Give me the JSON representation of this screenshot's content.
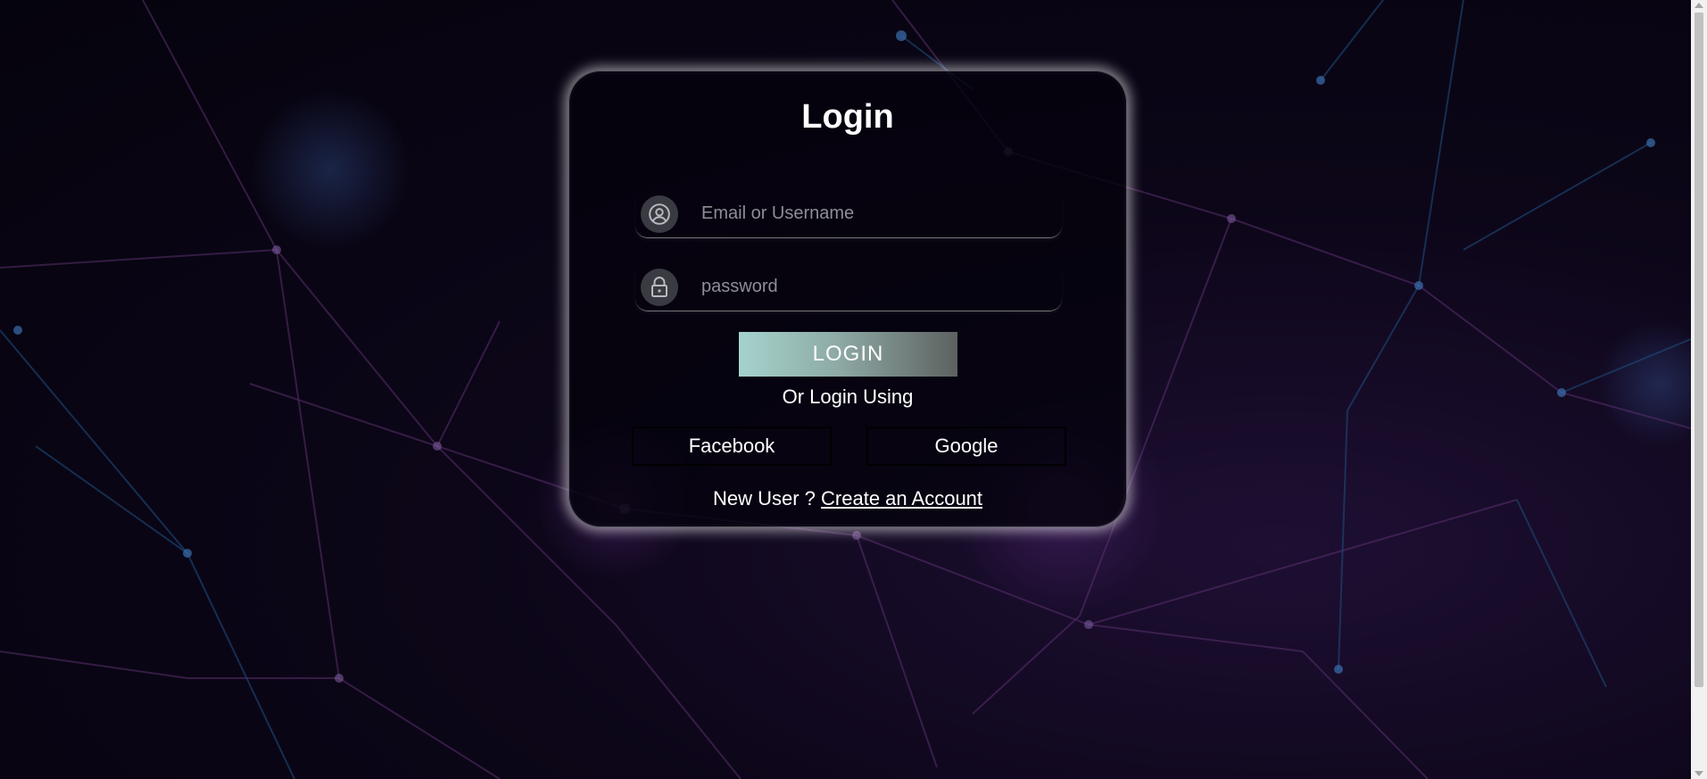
{
  "login": {
    "title": "Login",
    "email_placeholder": "Email or Username",
    "password_placeholder": "password",
    "login_button": "LOGIN",
    "or_text": "Or Login Using",
    "facebook_button": "Facebook",
    "google_button": "Google",
    "new_user_text": "New User ?",
    "create_account_link": "Create an Account"
  },
  "icons": {
    "email": "user-circle-icon",
    "password": "lock-icon"
  },
  "colors": {
    "background": "#0a0616",
    "card_background": "#05020e",
    "card_glow": "#ffffff",
    "login_gradient_start": "#a5d3cc",
    "login_gradient_end": "#5d615f",
    "placeholder": "#8e8e96"
  }
}
